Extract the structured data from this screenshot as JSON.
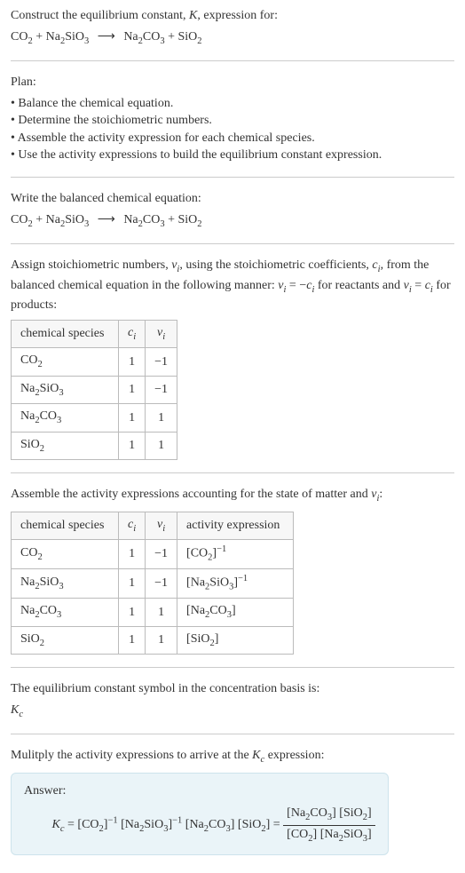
{
  "header": {
    "line1": "Construct the equilibrium constant, ",
    "k": "K",
    "line1b": ", expression for:"
  },
  "reaction": {
    "r1": "CO",
    "r1sub": "2",
    "plus": " + ",
    "r2a": "Na",
    "r2sub1": "2",
    "r2b": "SiO",
    "r2sub2": "3",
    "arrow": "⟶",
    "p1a": "Na",
    "p1sub1": "2",
    "p1b": "CO",
    "p1sub2": "3",
    "p2a": "SiO",
    "p2sub": "2"
  },
  "plan": {
    "title": "Plan:",
    "items": [
      "Balance the chemical equation.",
      "Determine the stoichiometric numbers.",
      "Assemble the activity expression for each chemical species.",
      "Use the activity expressions to build the equilibrium constant expression."
    ]
  },
  "balanced": {
    "title": "Write the balanced chemical equation:"
  },
  "stoich": {
    "intro1": "Assign stoichiometric numbers, ",
    "nu": "ν",
    "sub_i": "i",
    "intro2": ", using the stoichiometric coefficients, ",
    "c": "c",
    "intro3": ", from the balanced chemical equation in the following manner: ",
    "eq1a": "ν",
    "eq1b": " = −",
    "eq1c": "c",
    "intro4": " for reactants and ",
    "eq2a": "ν",
    "eq2b": " = ",
    "eq2c": "c",
    "intro5": " for products:"
  },
  "table1": {
    "headers": {
      "species": "chemical species",
      "ci": "c",
      "nui": "ν"
    },
    "rows": [
      {
        "sp_a": "CO",
        "sp_s1": "2",
        "sp_b": "",
        "sp_s2": "",
        "c": "1",
        "nu": "−1"
      },
      {
        "sp_a": "Na",
        "sp_s1": "2",
        "sp_b": "SiO",
        "sp_s2": "3",
        "c": "1",
        "nu": "−1"
      },
      {
        "sp_a": "Na",
        "sp_s1": "2",
        "sp_b": "CO",
        "sp_s2": "3",
        "c": "1",
        "nu": "1"
      },
      {
        "sp_a": "SiO",
        "sp_s1": "2",
        "sp_b": "",
        "sp_s2": "",
        "c": "1",
        "nu": "1"
      }
    ]
  },
  "assemble": {
    "text1": "Assemble the activity expressions accounting for the state of matter and ",
    "nu": "ν",
    "sub_i": "i",
    "text2": ":"
  },
  "table2": {
    "headers": {
      "species": "chemical species",
      "ci": "c",
      "nui": "ν",
      "act": "activity expression"
    },
    "rows": [
      {
        "sp_a": "CO",
        "sp_s1": "2",
        "sp_b": "",
        "sp_s2": "",
        "c": "1",
        "nu": "−1",
        "ae_a": "[CO",
        "ae_s1": "2",
        "ae_b": "]",
        "ae_sup": "−1",
        "ae_c": "",
        "ae_s2": "",
        "has_sup": true
      },
      {
        "sp_a": "Na",
        "sp_s1": "2",
        "sp_b": "SiO",
        "sp_s2": "3",
        "c": "1",
        "nu": "−1",
        "ae_a": "[Na",
        "ae_s1": "2",
        "ae_b": "SiO",
        "ae_s2": "3",
        "ae_c": "]",
        "ae_sup": "−1",
        "has_sup": true
      },
      {
        "sp_a": "Na",
        "sp_s1": "2",
        "sp_b": "CO",
        "sp_s2": "3",
        "c": "1",
        "nu": "1",
        "ae_a": "[Na",
        "ae_s1": "2",
        "ae_b": "CO",
        "ae_s2": "3",
        "ae_c": "]",
        "ae_sup": "",
        "has_sup": false
      },
      {
        "sp_a": "SiO",
        "sp_s1": "2",
        "sp_b": "",
        "sp_s2": "",
        "c": "1",
        "nu": "1",
        "ae_a": "[SiO",
        "ae_s1": "2",
        "ae_b": "]",
        "ae_s2": "",
        "ae_c": "",
        "ae_sup": "",
        "has_sup": false
      }
    ]
  },
  "kc_symbol": {
    "text": "The equilibrium constant symbol in the concentration basis is:",
    "k": "K",
    "sub": "c"
  },
  "multiply": {
    "text1": "Mulitply the activity expressions to arrive at the ",
    "k": "K",
    "sub": "c",
    "text2": " expression:"
  },
  "answer": {
    "label": "Answer:",
    "lhs_k": "K",
    "lhs_sub": "c",
    "eq": " = ",
    "t1a": "[CO",
    "t1s": "2",
    "t1b": "]",
    "t1sup": "−1",
    "t2a": " [Na",
    "t2s1": "2",
    "t2b": "SiO",
    "t2s2": "3",
    "t2c": "]",
    "t2sup": "−1",
    "t3a": " [Na",
    "t3s1": "2",
    "t3b": "CO",
    "t3s2": "3",
    "t3c": "]",
    "t4a": " [SiO",
    "t4s": "2",
    "t4b": "] = ",
    "num_a": "[Na",
    "num_s1": "2",
    "num_b": "CO",
    "num_s2": "3",
    "num_c": "] [SiO",
    "num_s3": "2",
    "num_d": "]",
    "den_a": "[CO",
    "den_s1": "2",
    "den_b": "] [Na",
    "den_s2": "2",
    "den_c": "SiO",
    "den_s3": "3",
    "den_d": "]"
  }
}
